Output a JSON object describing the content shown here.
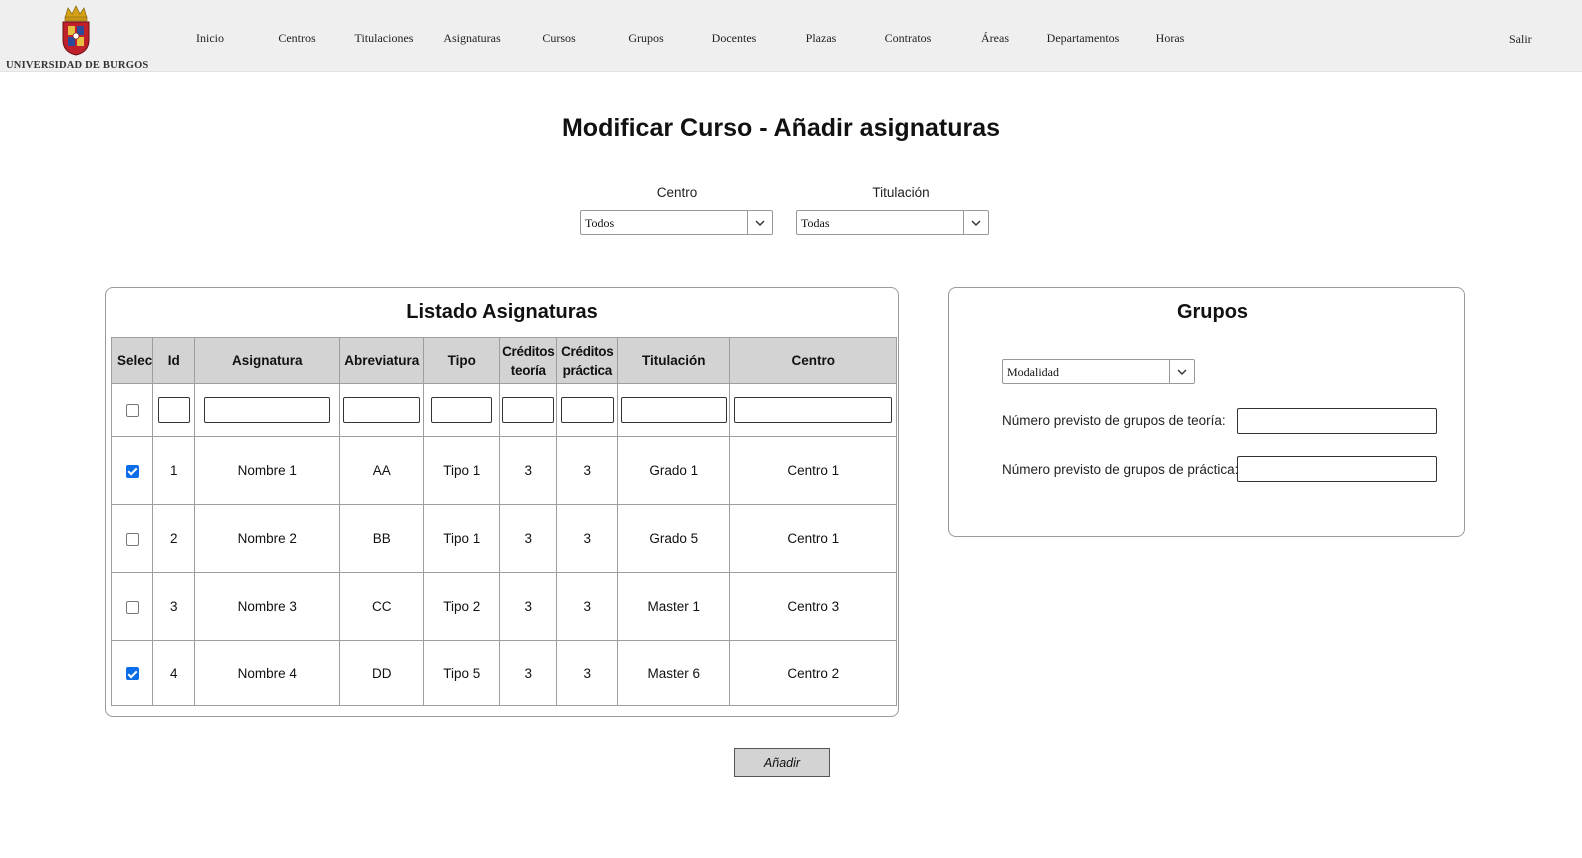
{
  "header": {
    "logo_text": "UNIVERSIDAD DE BURGOS",
    "nav": [
      "Inicio",
      "Centros",
      "Titulaciones",
      "Asignaturas",
      "Cursos",
      "Grupos",
      "Docentes",
      "Plazas",
      "Contratos",
      "Áreas",
      "Departamentos",
      "Horas"
    ],
    "exit_label": "Salir"
  },
  "page_title": "Modificar Curso - Añadir asignaturas",
  "filters": {
    "centro": {
      "label": "Centro",
      "value": "Todos"
    },
    "titulacion": {
      "label": "Titulación",
      "value": "Todas"
    }
  },
  "subjects_panel": {
    "title": "Listado Asignaturas",
    "columns": [
      "Selec",
      "Id",
      "Asignatura",
      "Abreviatura",
      "Tipo",
      "Créditos teoría",
      "Créditos práctica",
      "Titulación",
      "Centro"
    ],
    "filter_row": {
      "select_all_checked": false,
      "values": [
        "",
        "",
        "",
        "",
        "",
        "",
        "",
        ""
      ]
    },
    "rows": [
      {
        "selected": true,
        "cells": [
          "1",
          "Nombre 1",
          "AA",
          "Tipo 1",
          "3",
          "3",
          "Grado 1",
          "Centro 1"
        ]
      },
      {
        "selected": false,
        "cells": [
          "2",
          "Nombre 2",
          "BB",
          "Tipo 1",
          "3",
          "3",
          "Grado 5",
          "Centro 1"
        ]
      },
      {
        "selected": false,
        "cells": [
          "3",
          "Nombre 3",
          "CC",
          "Tipo 2",
          "3",
          "3",
          "Master 1",
          "Centro 3"
        ]
      },
      {
        "selected": true,
        "cells": [
          "4",
          "Nombre 4",
          "DD",
          "Tipo 5",
          "3",
          "3",
          "Master 6",
          "Centro 2"
        ]
      }
    ]
  },
  "groups_panel": {
    "title": "Grupos",
    "modalidad": {
      "value": "Modalidad"
    },
    "theory_groups": {
      "label": "Número previsto de grupos de teoría:",
      "value": ""
    },
    "practice_groups": {
      "label": "Número previsto de grupos de práctica:",
      "value": ""
    }
  },
  "add_button_label": "Añadir",
  "colors": {
    "header_bg": "#efefef",
    "table_header_bg": "#d3d3d3",
    "checkbox_checked": "#0b6ee8",
    "shield_red": "#c0202a",
    "shield_blue": "#2c4a9a",
    "crown_gold": "#d4a017"
  }
}
